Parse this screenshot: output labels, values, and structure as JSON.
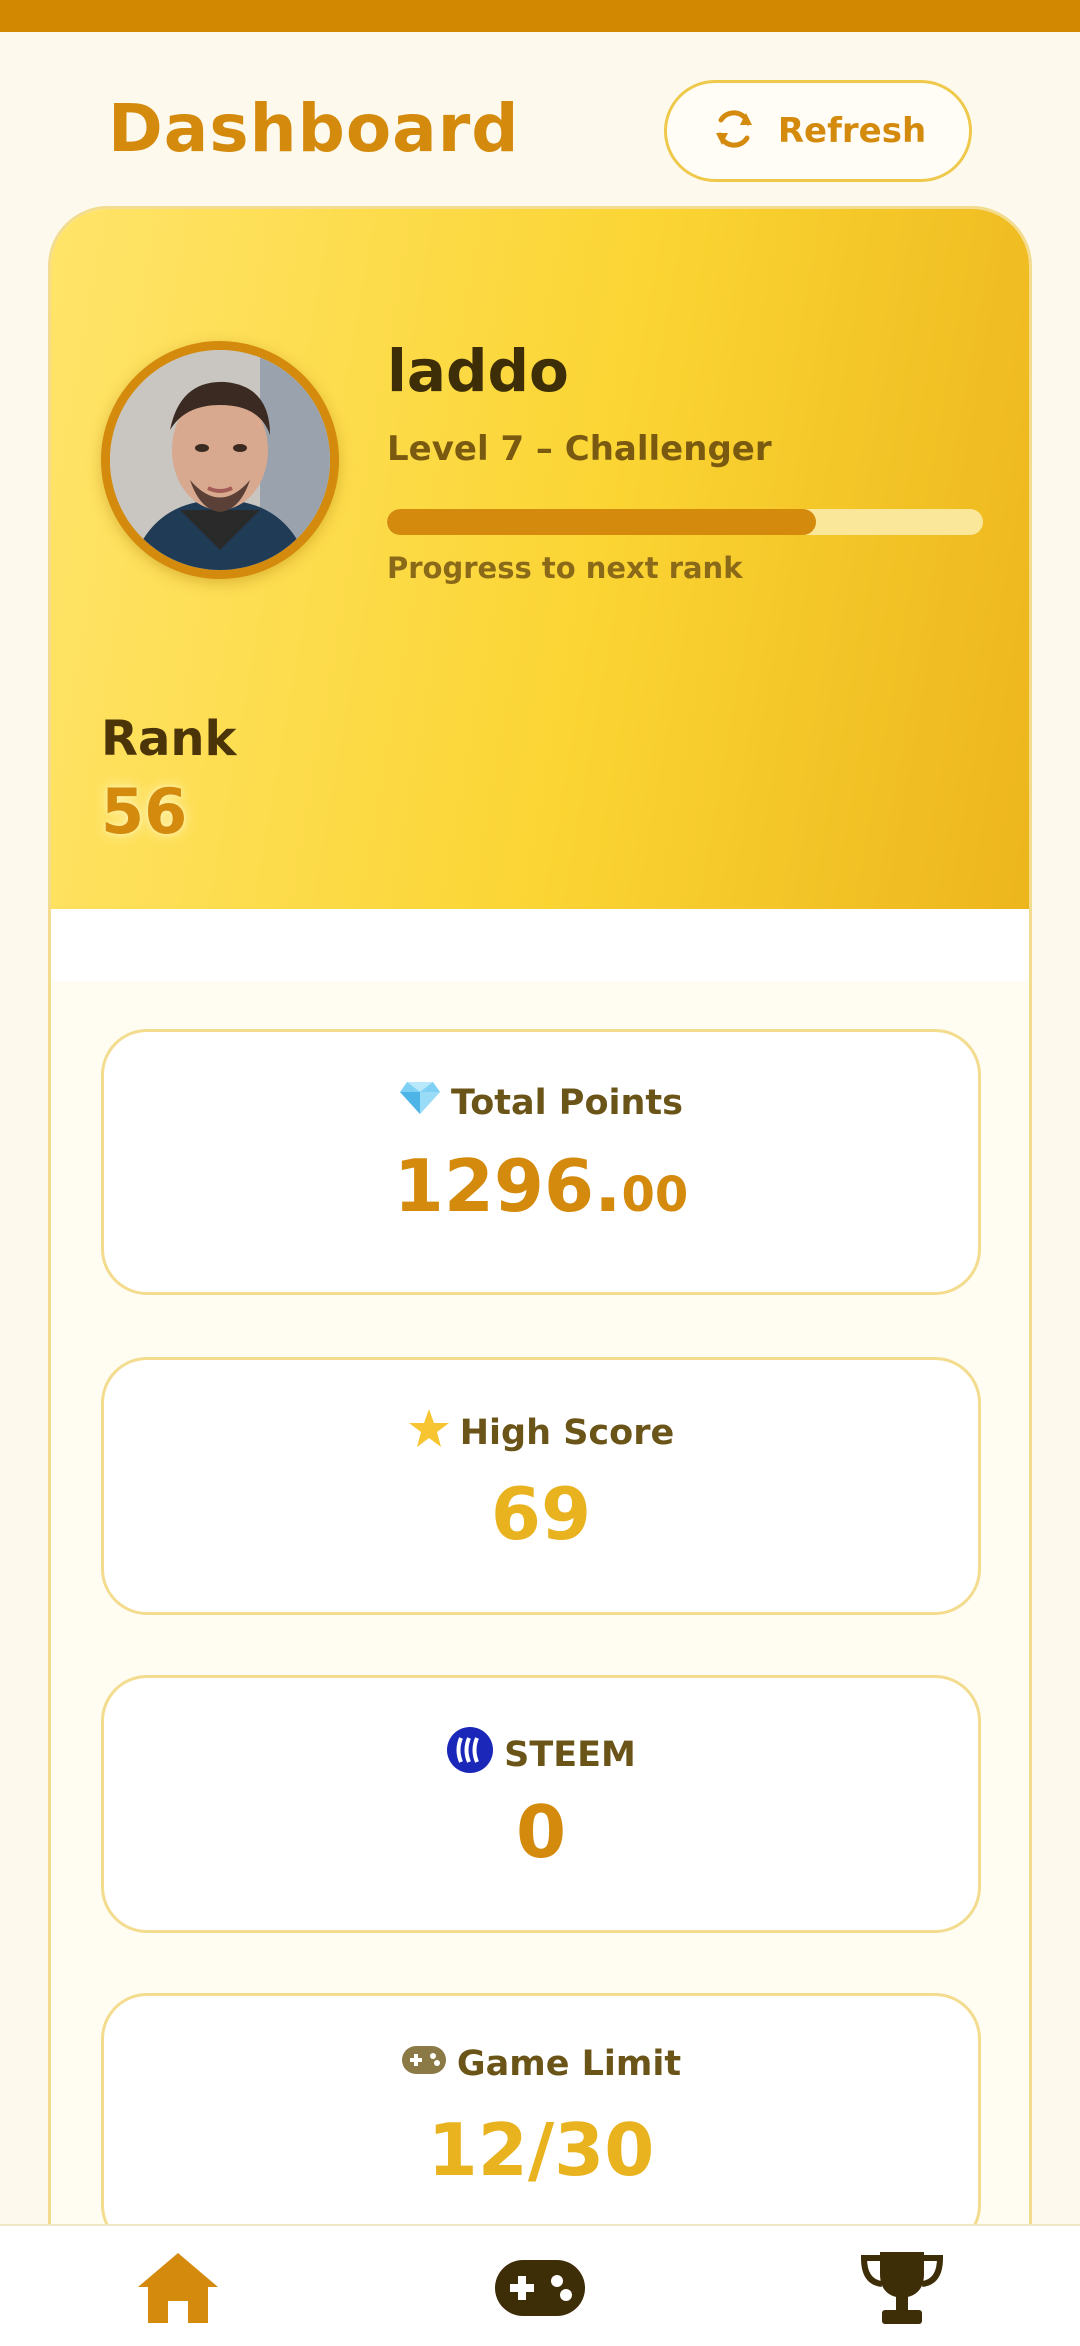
{
  "header": {
    "title": "Dashboard",
    "refresh_label": "Refresh"
  },
  "profile": {
    "username": "laddo",
    "level_text": "Level 7 – Challenger",
    "progress_fraction": 0.72,
    "progress_caption": "Progress to next rank",
    "rank_label": "Rank",
    "rank_value": "56"
  },
  "stats": [
    {
      "icon": "gem-icon",
      "label": "Total Points",
      "value_int": "1296.",
      "value_dec": "00",
      "color": "#d48a0c"
    },
    {
      "icon": "star-icon",
      "label": "High Score",
      "value_int": "69",
      "value_dec": "",
      "color": "#e9b320"
    },
    {
      "icon": "steem-icon",
      "label": "STEEM",
      "value_int": "0",
      "value_dec": "",
      "color": "#d48a0c"
    },
    {
      "icon": "gamepad-icon",
      "label": "Game Limit",
      "value_int": "12/30",
      "value_dec": "",
      "color": "#e9b320"
    }
  ],
  "nav": {
    "items": [
      "home-icon",
      "gamepad-icon",
      "trophy-icon"
    ]
  },
  "colors": {
    "accent": "#d48a0c",
    "gold": "#fbd533",
    "background": "#fdf9ec"
  }
}
